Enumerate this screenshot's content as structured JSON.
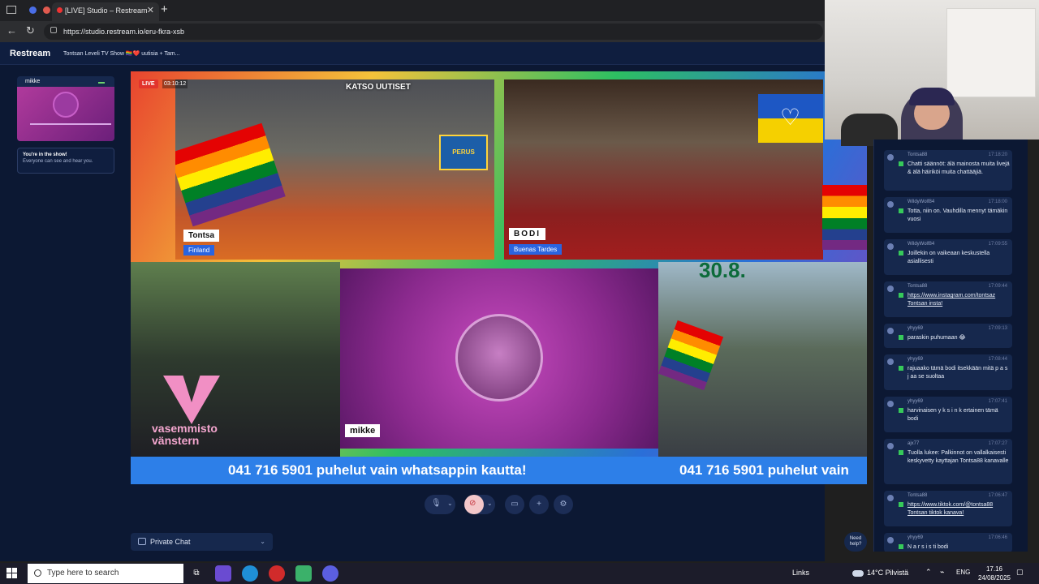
{
  "browser": {
    "tab_title": "[LIVE] Studio – Restream",
    "tab_close": "✕",
    "new_tab": "+",
    "url": "https://studio.restream.io/eru-fkra-xsb",
    "back": "←",
    "reload": "↻"
  },
  "restream": {
    "logo": "Restream",
    "show_title": "Tontsan Leveli TV Show 🏳️‍🌈❤️ uutisia + Tam...",
    "participant_name": "mikke",
    "in_show_title": "You're in the show!",
    "in_show_desc": "Everyone can see and hear you."
  },
  "stream": {
    "live_label": "LIVE",
    "timer": "03:10:12",
    "tontsa_overlay": "KATSO UUTISET",
    "tontsa_name": "Tontsa",
    "tontsa_sub": "Finland",
    "tontsa_badge": "PERUS",
    "bodi_name": "BODI",
    "bodi_sub": "Buenas Tardes",
    "mikke_name": "mikke",
    "vas_text_1": "vasemmisto",
    "vas_text_2": "vänstern",
    "date_text": "30.8.",
    "ticker_text": "041 716 5901 puhelut vain whatsappin kautta!",
    "ticker_text_repeat": "041 716 5901 puhelut vain"
  },
  "controls": {
    "caret": "⌄",
    "add": "+",
    "settings": "⚙",
    "share": "▭",
    "private_chat": "Private Chat",
    "need_help_1": "Need",
    "need_help_2": "help?"
  },
  "chat": [
    {
      "user": "Tontsa88",
      "time": "17:18:20",
      "text": "Chatti säännöt: älä mainosta muita livejä & älä häiriköi muita chattääjiä.",
      "link": false
    },
    {
      "user": "WildyWolf84",
      "time": "17:18:00",
      "text": "Totta, niin on. Vauhdilla mennyt tämäkin vuosi",
      "link": false
    },
    {
      "user": "WildyWolf84",
      "time": "17:09:55",
      "text": "Joillekin on vaikeaan keskustella asiallisesti",
      "link": false
    },
    {
      "user": "Tontsa88",
      "time": "17:09:44",
      "text": "https://www.instagram.com/tontsaz Tontsan insta!",
      "link": true
    },
    {
      "user": "yhyy69",
      "time": "17:09:13",
      "text": "paraskin puhumaan 😂",
      "link": false
    },
    {
      "user": "yhyy69",
      "time": "17:08:44",
      "text": "rajuaako tämä bodi itsekkään mitä p a s j aa se suoltaa",
      "link": false
    },
    {
      "user": "yhyy69",
      "time": "17:07:41",
      "text": "harvinaisen y k s i n k ertainen tämä bodi",
      "link": false
    },
    {
      "user": "ajx77",
      "time": "17:07:27",
      "text": "Tuolla lukee: Palkinnot on vallalkaisesti keskyvetty kayttajan Tontsa88 kanavalle",
      "link": false
    },
    {
      "user": "Tontsa88",
      "time": "17:06:47",
      "text": "https://www.tiktok.com/@tontsa88 Tontsan tiktok kanava!",
      "link": true
    },
    {
      "user": "yhyy69",
      "time": "17:06:46",
      "text": "N a r s i s ti bodi",
      "link": false
    }
  ],
  "taskbar": {
    "search_placeholder": "Type here to search",
    "links": "Links",
    "weather": "14°C Pilvistä",
    "lang": "ENG",
    "time": "17.16",
    "date": "24/08/2025"
  },
  "colors": {
    "app_bg": "#0c1833",
    "ticker": "#2d7fe8",
    "live": "#e2342c"
  }
}
